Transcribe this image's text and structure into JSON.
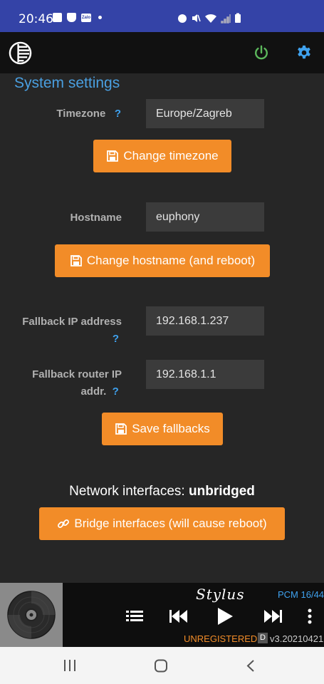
{
  "status_bar": {
    "time": "20:46",
    "notification_icons": [
      "gallery-icon",
      "shield-icon",
      "zalo-icon",
      "dot-icon"
    ],
    "zalo_text": "Zalo",
    "system_icons": [
      "alarm-icon",
      "mute-icon",
      "wifi-icon",
      "signal-icon",
      "battery-icon"
    ]
  },
  "app_bar": {
    "power_color": "#5cb85c",
    "gear_color": "#3fa2ef"
  },
  "settings": {
    "section_title": "System settings",
    "help_mark": "?",
    "timezone": {
      "label": "Timezone",
      "value": "Europe/Zagreb",
      "button": "Change timezone"
    },
    "hostname": {
      "label": "Hostname",
      "value": "euphony",
      "button": "Change hostname (and reboot)"
    },
    "fallback_ip": {
      "label": "Fallback IP address",
      "value": "192.168.1.237"
    },
    "fallback_router": {
      "label_line1": "Fallback router IP",
      "label_line2": "addr.",
      "value": "192.168.1.1"
    },
    "save_fallbacks_button": "Save fallbacks",
    "network": {
      "label": "Network interfaces:",
      "state": "unbridged",
      "button": "Bridge interfaces (will cause reboot)"
    }
  },
  "player": {
    "logo_text": "Stylus",
    "format": "PCM 16/44",
    "license": "UNREGISTERED",
    "badge": "D",
    "version": "v3.20210421"
  },
  "colors": {
    "accent": "#f28c28",
    "link": "#3fa2ef",
    "status_bar": "#3443a7"
  }
}
